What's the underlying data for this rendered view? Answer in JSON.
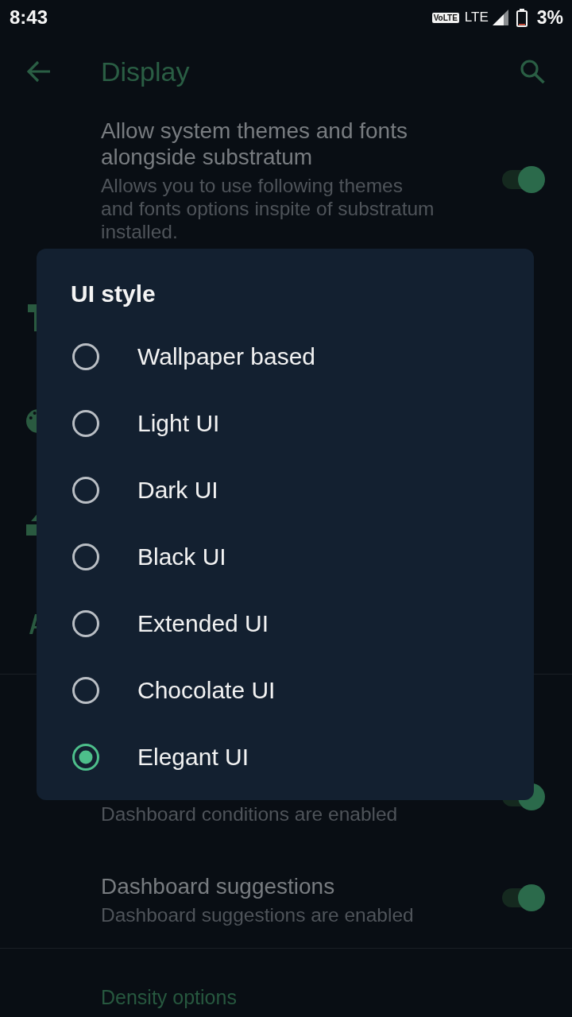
{
  "status_bar": {
    "time": "8:43",
    "volte": "VoLTE",
    "network": "LTE",
    "battery": "3%"
  },
  "app_bar": {
    "title": "Display"
  },
  "preferences": [
    {
      "kind": "switch",
      "title": "Allow system themes and fonts alongside substratum",
      "summary": "Allows you to use following themes and fonts options inspite of substratum installed.",
      "on": true
    }
  ],
  "preferences_below": [
    {
      "kind": "switch",
      "summary": "Dashboard conditions are enabled",
      "on": true
    },
    {
      "kind": "switch",
      "title": "Dashboard suggestions",
      "summary": "Dashboard suggestions are enabled",
      "on": true
    }
  ],
  "category_header": "Density options",
  "dialog": {
    "title": "UI style",
    "options": [
      {
        "label": "Wallpaper based",
        "selected": false
      },
      {
        "label": "Light UI",
        "selected": false
      },
      {
        "label": "Dark UI",
        "selected": false
      },
      {
        "label": "Black UI",
        "selected": false
      },
      {
        "label": "Extended UI",
        "selected": false
      },
      {
        "label": "Chocolate UI",
        "selected": false
      },
      {
        "label": "Elegant UI",
        "selected": true
      }
    ]
  }
}
